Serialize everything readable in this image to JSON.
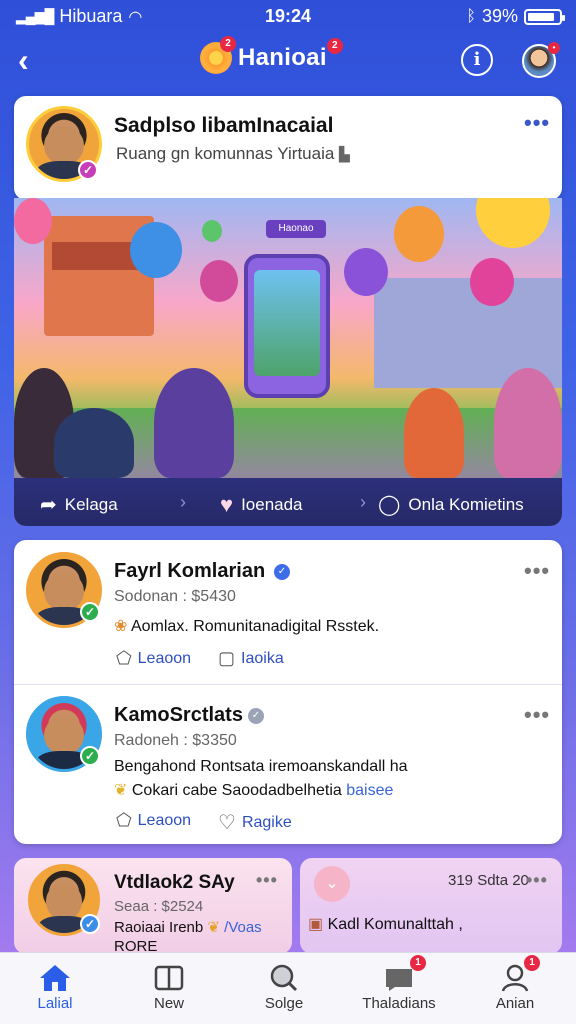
{
  "status": {
    "carrier": "Hibuara",
    "time": "19:24",
    "battery": "39%"
  },
  "header": {
    "title": "Hanioai",
    "brand_badge": "2",
    "title_badge": "2",
    "info_icon": "info-icon",
    "avatar_badge": "•"
  },
  "post": {
    "name": "Sadplso libamInacaial",
    "subtitle": "Ruang gn komunnas Yirtuaia",
    "hero_sign": "Haonao",
    "actions": [
      {
        "label": "Kelaga",
        "icon": "share-icon"
      },
      {
        "label": "Ioenada",
        "icon": "heart-icon"
      },
      {
        "label": "Onla Komietins",
        "icon": "comment-icon"
      }
    ]
  },
  "feed": [
    {
      "name": "Fayrl Komlarian",
      "meta": "Sodonan : $5430",
      "text": "Aomlax. Romunitanadigital Rsstek.",
      "actions": [
        "Leaoon",
        "Iaoika"
      ],
      "verified_color": "#3d6de8",
      "check_color": "#2cae4d"
    },
    {
      "name": "KamoSrctlats",
      "meta": "Radoneh : $3350",
      "text": "Bengahond Rontsata iremoanskandall ha",
      "text2": "Cokari cabe Saoodadbelhetia",
      "text2_link": "baisee",
      "actions": [
        "Leaoon",
        "Ragike"
      ],
      "verified_color": "#9aa4b4",
      "check_color": "#2cae4d"
    }
  ],
  "mini_cards": [
    {
      "name": "Vtdlaok2 SAy",
      "meta": "Seaa : $2524",
      "text": "Raoiaai Irenb",
      "text_tail": "/Voas",
      "text3": "RORE"
    },
    {
      "meta": "319 Sdta 20",
      "text": "Kadl Komunalttah ,"
    }
  ],
  "tabs": [
    {
      "label": "Lalial",
      "icon": "home-icon",
      "active": true
    },
    {
      "label": "New",
      "icon": "book-icon",
      "active": false
    },
    {
      "label": "Solge",
      "icon": "search-icon",
      "active": false
    },
    {
      "label": "Thaladians",
      "icon": "message-icon",
      "active": false,
      "badge": "1"
    },
    {
      "label": "Anian",
      "icon": "profile-icon",
      "active": false,
      "badge": "1"
    }
  ]
}
